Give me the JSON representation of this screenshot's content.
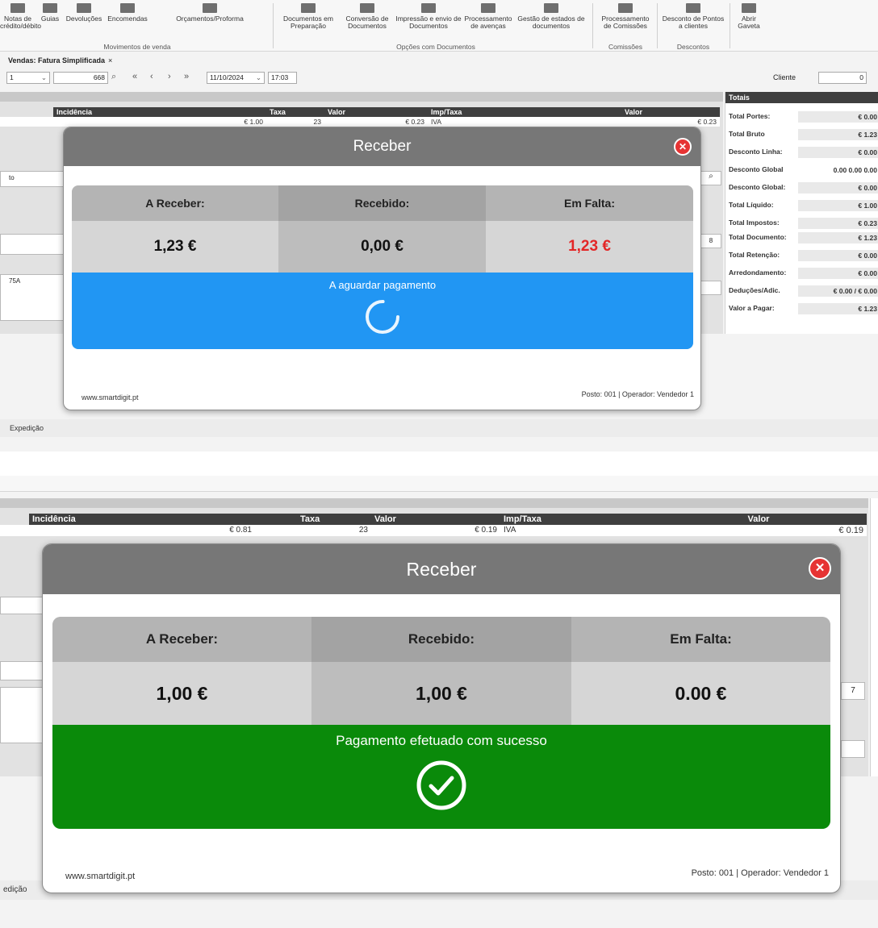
{
  "shot1": {
    "ribbon": {
      "items": [
        {
          "label": "Notas de crédito/débito"
        },
        {
          "label": "Guias"
        },
        {
          "label": "Devoluções"
        },
        {
          "label": "Encomendas"
        },
        {
          "label": "Orçamentos/Proforma"
        },
        {
          "label": "Documentos em Preparação"
        },
        {
          "label": "Conversão de Documentos"
        },
        {
          "label": "Impressão e envio de Documentos"
        },
        {
          "label": "Processamento de avenças"
        },
        {
          "label": "Gestão de estados de documentos"
        },
        {
          "label": "Processamento de Comissões"
        },
        {
          "label": "Desconto de Pontos a clientes"
        },
        {
          "label": "Abrir Gaveta"
        }
      ],
      "groups": {
        "movimentos": "Movimentos de venda",
        "opcoes": "Opções com Documentos",
        "comissoes": "Comissões",
        "descontos": "Descontos"
      }
    },
    "doc_tab": {
      "label": "Vendas: Fatura Simplificada",
      "close": "×"
    },
    "toolbar": {
      "series": "1",
      "number": "668",
      "date": "11/10/2024",
      "time": "17:03",
      "client_label": "Cliente",
      "client_value": "0"
    },
    "grid_headers": {
      "incidencia": "Incidência",
      "taxa": "Taxa",
      "valor": "Valor",
      "imp_taxa": "Imp/Taxa",
      "valor2": "Valor"
    },
    "grid_row": {
      "incidencia": "€ 1.00",
      "taxa": "23",
      "valor": "€ 0.23",
      "imp_taxa": "IVA",
      "valor2": "€ 0.23"
    },
    "left_fragments": {
      "a": "to",
      "b": "75A",
      "spin": "8"
    },
    "totals": {
      "title": "Totais",
      "rows": [
        {
          "label": "Total Portes:",
          "value": "€ 0.00"
        },
        {
          "label": "Total Bruto",
          "value": "€ 1.23"
        },
        {
          "label": "Desconto Linha:",
          "value": "€ 0.00"
        },
        {
          "label": "Desconto Global",
          "value": "0.00   0.00   0.00"
        },
        {
          "label": "Desconto Global:",
          "value": "€ 0.00"
        },
        {
          "label": "Total Líquido:",
          "value": "€ 1.00"
        },
        {
          "label": "Total Impostos:",
          "value": "€ 0.23"
        },
        {
          "label": "Total Documento:",
          "value": "€ 1.23"
        },
        {
          "label": "Total Retenção:",
          "value": "€ 0.00"
        },
        {
          "label": "Arredondamento:",
          "value": "€ 0.00"
        },
        {
          "label": "Deduções/Adic.",
          "value": "€ 0.00 / € 0.00"
        },
        {
          "label": "Valor a Pagar:",
          "value": "€ 1.23"
        }
      ]
    },
    "bottom_tab": "Expedição",
    "modal": {
      "title": "Receber",
      "close": "✕",
      "a_receber_label": "A Receber:",
      "recebido_label": "Recebido:",
      "em_falta_label": "Em Falta:",
      "a_receber_value": "1,23 €",
      "recebido_value": "0,00 €",
      "em_falta_value": "1,23 €",
      "status_text": "A aguardar pagamento",
      "status_icon": "spinner-icon",
      "status_color": "#2196f3",
      "em_falta_color": "#e32626",
      "website": "www.smartdigit.pt",
      "post_info": "Posto: 001 | Operador: Vendedor 1"
    }
  },
  "shot2": {
    "grid_headers": {
      "incidencia": "Incidência",
      "taxa": "Taxa",
      "valor": "Valor",
      "imp_taxa": "Imp/Taxa",
      "valor2": "Valor"
    },
    "grid_row": {
      "incidencia": "€ 0.81",
      "taxa": "23",
      "valor": "€ 0.19",
      "imp_taxa": "IVA",
      "valor2": "€ 0.19"
    },
    "left_fragments": {
      "spin": "7"
    },
    "bottom_tab": "edição",
    "modal": {
      "title": "Receber",
      "close": "✕",
      "a_receber_label": "A Receber:",
      "recebido_label": "Recebido:",
      "em_falta_label": "Em Falta:",
      "a_receber_value": "1,00 €",
      "recebido_value": "1,00 €",
      "em_falta_value": "0.00 €",
      "status_text": "Pagamento efetuado com sucesso",
      "status_icon": "check-circle-icon",
      "status_color": "#0a8a0a",
      "website": "www.smartdigit.pt",
      "post_info": "Posto: 001 | Operador: Vendedor 1"
    }
  }
}
